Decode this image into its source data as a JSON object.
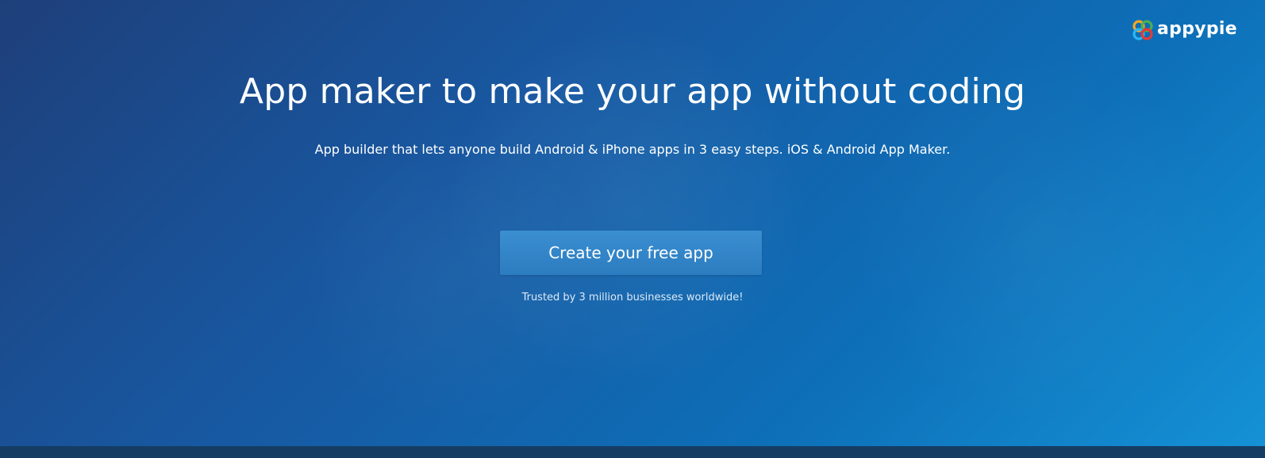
{
  "brand": {
    "name": "appypie",
    "logo_icon": "appypie-logo-icon",
    "logo_colors": [
      "#f5a623",
      "#4caf50",
      "#29b6f6",
      "#e53935"
    ]
  },
  "hero": {
    "title": "App maker to make your app without coding",
    "subtitle": "App builder that lets anyone build Android & iPhone apps in 3 easy steps. iOS & Android App Maker.",
    "cta_label": "Create your free app",
    "trust_text": "Trusted by 3 million businesses worldwide!"
  },
  "colors": {
    "background_start": "#1e3f7a",
    "background_end": "#1592d6",
    "cta_background": "#2f83c6",
    "bottom_bar": "#153d63"
  }
}
